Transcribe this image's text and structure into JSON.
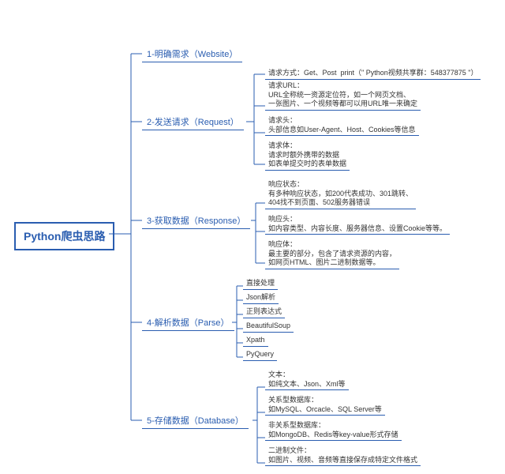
{
  "root": {
    "title": "Python爬虫思路"
  },
  "branches": [
    {
      "id": "b1",
      "label": "1-明确需求（Website）",
      "subs": []
    },
    {
      "id": "b2",
      "label": "2-发送请求（Request）",
      "subs": [
        {
          "text": "请求方式：Get、Post  print（\" Python视频共享群：548377875 \"）"
        },
        {
          "text": "请求URL：\nURL全称统一资源定位符，如一个网页文档、\n一张图片、一个视频等都可以用URL唯一来确定"
        },
        {
          "text": "请求头：\n头部信息如User-Agent、Host、Cookies等信息"
        },
        {
          "text": "请求体：\n请求时额外携带的数据\n如表单提交时的表单数据"
        }
      ]
    },
    {
      "id": "b3",
      "label": "3-获取数据（Response）",
      "subs": [
        {
          "text": "响应状态：\n有多种响应状态，如200代表成功、301跳转、\n404找不到页面、502服务器错误"
        },
        {
          "text": "响应头：\n如内容类型、内容长度、服务器信息、设置Cookie等等。"
        },
        {
          "text": "响应体：\n最主要的部分，包含了请求资源的内容，\n如网页HTML、图片二进制数据等。"
        }
      ]
    },
    {
      "id": "b4",
      "label": "4-解析数据（Parse）",
      "subs": [
        {
          "text": "直接处理"
        },
        {
          "text": "Json解析"
        },
        {
          "text": "正则表达式"
        },
        {
          "text": "BeautifulSoup"
        },
        {
          "text": "Xpath"
        },
        {
          "text": "PyQuery"
        }
      ]
    },
    {
      "id": "b5",
      "label": "5-存储数据（Database）",
      "subs": [
        {
          "text": "文本：\n如纯文本、Json、Xml等"
        },
        {
          "text": "关系型数据库：\n如MySQL、Orcacle、SQL Server等"
        },
        {
          "text": "非关系型数据库：\n如MongoDB、Redis等key-value形式存储"
        },
        {
          "text": "二进制文件：\n如图片、视频、音频等直接保存成特定文件格式"
        }
      ]
    }
  ]
}
